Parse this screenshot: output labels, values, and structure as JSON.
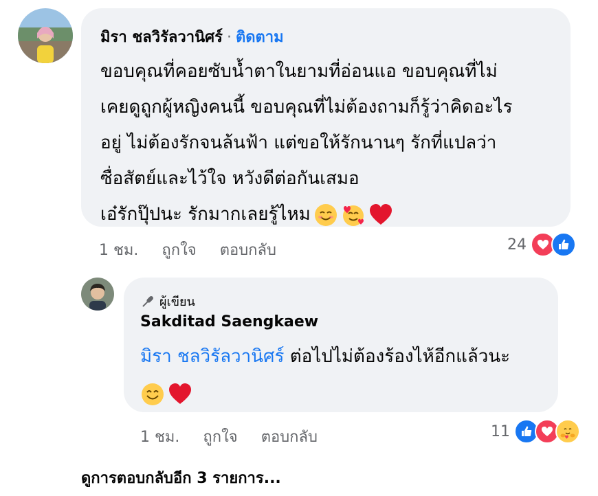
{
  "comment1": {
    "author": "มิรา ชลวิรัลวานิศร์",
    "separator": "·",
    "follow_label": "ติดตาม",
    "lines": [
      "ขอบคุณที่คอยซับน้ำตาในยามที่อ่อนแอ ขอบคุณที่ไม่",
      "เคยดูถูกผู้หญิงคนนี้ ขอบคุณที่ไม่ต้องถามก็รู้ว่าคิดอะไร",
      "อยู่ ไม่ต้องรักจนล้นฟ้า แต่ขอให้รักนานๆ รักที่แปลว่า",
      "ซื่อสัตย์และไว้ใจ หวังดีต่อกันเสมอ",
      "เอ๋รักปุ๊ปนะ รักมากเลยรู้ไหม"
    ],
    "emojis": [
      "smiling-face-icon",
      "smiling-face-with-hearts-icon",
      "red-heart-icon"
    ],
    "time": "1 ชม.",
    "like_label": "ถูกใจ",
    "reply_label": "ตอบกลับ",
    "reaction_count": "24",
    "reactions": [
      "love-reaction-icon",
      "like-reaction-icon"
    ]
  },
  "reply1": {
    "badge_label": "ผู้เขียน",
    "author": "Sakditad Saengkaew",
    "mention": "มิรา ชลวิรัลวานิศร์",
    "text": " ต่อไปไม่ต้องร้องไห้อีกแล้วนะ",
    "emojis": [
      "smiling-face-icon",
      "red-heart-icon"
    ],
    "time": "1 ชม.",
    "like_label": "ถูกใจ",
    "reply_label": "ตอบกลับ",
    "reaction_count": "11",
    "reactions": [
      "like-reaction-icon",
      "love-reaction-icon",
      "care-reaction-icon"
    ]
  },
  "more_replies_label": "ดูการตอบกลับอีก 3 รายการ...",
  "colors": {
    "bubble": "#f0f2f5",
    "link_blue": "#1877f2",
    "secondary_text": "#65676b",
    "love_red": "#f33e58"
  }
}
